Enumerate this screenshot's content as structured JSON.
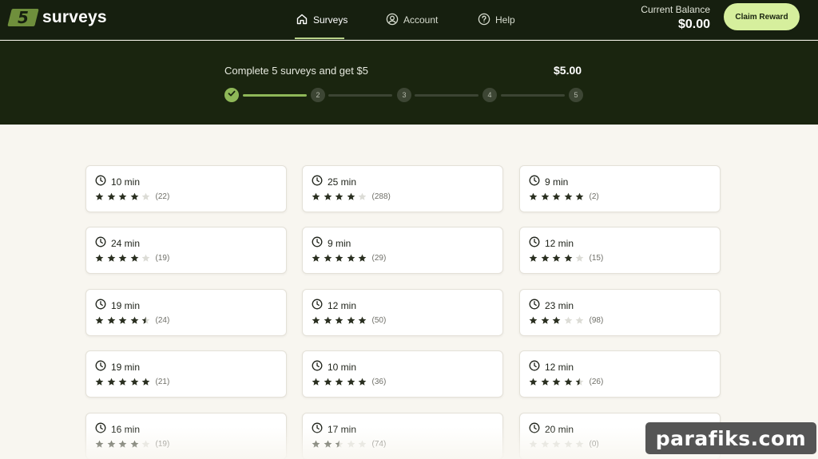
{
  "header": {
    "logo_mark": "5",
    "logo_text": "surveys",
    "nav": [
      {
        "label": "Surveys",
        "icon": "home-icon",
        "active": true
      },
      {
        "label": "Account",
        "icon": "user-circle-icon",
        "active": false
      },
      {
        "label": "Help",
        "icon": "help-circle-icon",
        "active": false
      }
    ],
    "balance_label": "Current Balance",
    "balance_value": "$0.00",
    "claim_label": "Claim Reward"
  },
  "progress": {
    "title": "Complete 5 surveys and get $5",
    "amount": "$5.00",
    "completed_steps": 1,
    "steps": [
      "1",
      "2",
      "3",
      "4",
      "5"
    ]
  },
  "surveys": [
    {
      "time": "10 min",
      "rating": 4,
      "count": "(22)"
    },
    {
      "time": "25 min",
      "rating": 4,
      "count": "(288)"
    },
    {
      "time": "9 min",
      "rating": 5,
      "count": "(2)"
    },
    {
      "time": "24 min",
      "rating": 4,
      "count": "(19)"
    },
    {
      "time": "9 min",
      "rating": 5,
      "count": "(29)"
    },
    {
      "time": "12 min",
      "rating": 4,
      "count": "(15)"
    },
    {
      "time": "19 min",
      "rating": 4.5,
      "count": "(24)"
    },
    {
      "time": "12 min",
      "rating": 5,
      "count": "(50)"
    },
    {
      "time": "23 min",
      "rating": 3,
      "count": "(98)"
    },
    {
      "time": "19 min",
      "rating": 5,
      "count": "(21)"
    },
    {
      "time": "10 min",
      "rating": 5,
      "count": "(36)"
    },
    {
      "time": "12 min",
      "rating": 4.5,
      "count": "(26)"
    },
    {
      "time": "16 min",
      "rating": 4,
      "count": "(19)"
    },
    {
      "time": "17 min",
      "rating": 2.5,
      "count": "(74)"
    },
    {
      "time": "20 min",
      "rating": 0,
      "count": "(0)"
    }
  ],
  "watermark": "parafiks.com",
  "colors": {
    "header_bg": "#161f0f",
    "progress_bg": "#1a250f",
    "accent": "#8fb858",
    "claim_bg": "#d6ef9d",
    "page_bg": "#f8f6f0",
    "star_filled": "#2a2f20",
    "star_empty": "#dcdcd6"
  }
}
